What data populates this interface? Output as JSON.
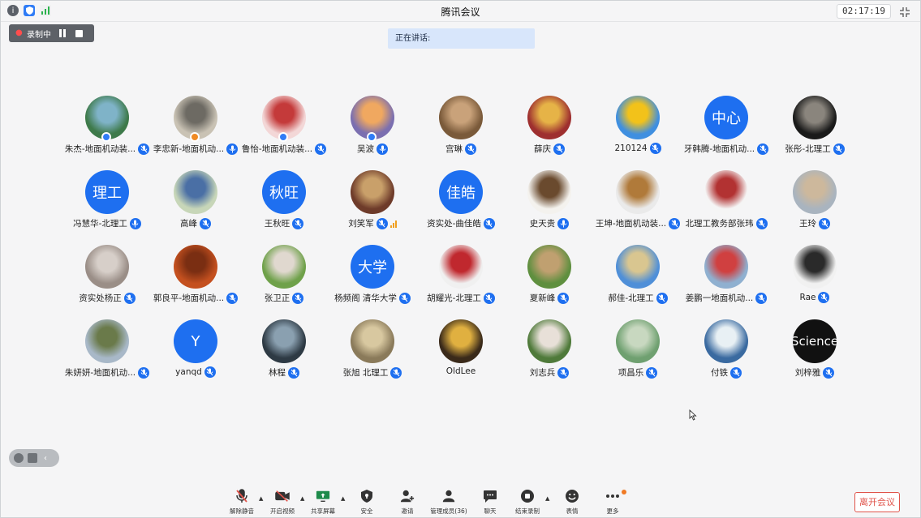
{
  "titlebar": {
    "title": "腾讯会议",
    "timer": "02:17:19"
  },
  "recording": {
    "label": "录制中"
  },
  "speaking": {
    "label": "正在讲话:"
  },
  "colors": {
    "accent": "#1e6ff0",
    "danger": "#e0534a",
    "record_red": "#ff4d4d"
  },
  "participants": [
    {
      "name": "朱杰-地面机动装...",
      "avatar": "photo-lake",
      "mic": "muted",
      "host": "blue"
    },
    {
      "name": "李忠新-地面机动...",
      "avatar": "photo-room",
      "mic": "on",
      "host": "orange"
    },
    {
      "name": "鲁怡-地面机动装...",
      "avatar": "photo-cartoon",
      "mic": "muted",
      "host": "blue"
    },
    {
      "name": "吴波",
      "avatar": "photo-sunset",
      "mic": "on",
      "host": "blue"
    },
    {
      "name": "宫琳",
      "avatar": "photo-man",
      "mic": "muted"
    },
    {
      "name": "薛庆",
      "avatar": "photo-shop",
      "mic": "muted"
    },
    {
      "name": "210124",
      "avatar": "photo-sunflower",
      "mic": "muted"
    },
    {
      "name": "牙韩腾-地面机动...",
      "avatar_text": "中心",
      "mic": "muted"
    },
    {
      "name": "张彤-北理工",
      "avatar": "photo-statue",
      "mic": "muted"
    },
    {
      "name": "冯慧华-北理工",
      "avatar_text": "理工",
      "mic": "on"
    },
    {
      "name": "高峰",
      "avatar": "photo-runner",
      "mic": "muted"
    },
    {
      "name": "王秋旺",
      "avatar_text": "秋旺",
      "mic": "muted"
    },
    {
      "name": "刘笑军",
      "avatar": "photo-books",
      "mic": "muted",
      "speaking": true
    },
    {
      "name": "资实处-曲佳皓",
      "avatar_text": "佳皓",
      "mic": "muted"
    },
    {
      "name": "史天贵",
      "avatar": "photo-coconut",
      "mic": "on"
    },
    {
      "name": "王坤-地面机动装...",
      "avatar": "photo-cartoon2",
      "mic": "muted"
    },
    {
      "name": "北理工教务部张玮",
      "avatar": "photo-logo",
      "mic": "muted"
    },
    {
      "name": "王玲",
      "avatar": "photo-desert",
      "mic": "muted"
    },
    {
      "name": "资实处杨正",
      "avatar": "photo-shell",
      "mic": "muted"
    },
    {
      "name": "郭良平-地面机动...",
      "avatar": "photo-rock",
      "mic": "muted"
    },
    {
      "name": "张卫正",
      "avatar": "photo-woman",
      "mic": "muted"
    },
    {
      "name": "杨频阁 清华大学",
      "avatar_text": "大学",
      "mic": "muted"
    },
    {
      "name": "胡耀光-北理工",
      "avatar": "photo-portrait",
      "mic": "muted"
    },
    {
      "name": "夏新峰",
      "avatar": "photo-child",
      "mic": "muted"
    },
    {
      "name": "郝佳-北理工",
      "avatar": "photo-road",
      "mic": "muted"
    },
    {
      "name": "姜鹏一地面机动...",
      "avatar": "photo-bike",
      "mic": "muted"
    },
    {
      "name": "Rae",
      "avatar": "photo-art",
      "mic": "muted"
    },
    {
      "name": "朱妍妍-地面机动...",
      "avatar": "photo-girl",
      "mic": "muted"
    },
    {
      "name": "yanqd",
      "avatar_text": "Y",
      "mic": "muted"
    },
    {
      "name": "林程",
      "avatar": "photo-bus",
      "mic": "muted"
    },
    {
      "name": "张旭 北理工",
      "avatar": "photo-corridor",
      "mic": "muted"
    },
    {
      "name": "OldLee",
      "avatar": "photo-mosaic",
      "mic": "none"
    },
    {
      "name": "刘志兵",
      "avatar": "photo-football",
      "mic": "muted"
    },
    {
      "name": "项昌乐",
      "avatar": "photo-pond",
      "mic": "muted"
    },
    {
      "name": "付铁",
      "avatar": "photo-tree",
      "mic": "muted"
    },
    {
      "name": "刘梓雅",
      "avatar_text": "Science",
      "avatar_style": "dark",
      "mic": "muted"
    }
  ],
  "toolbar": {
    "mute": "解除静音",
    "video": "开启视频",
    "share": "共享屏幕",
    "security": "安全",
    "invite": "邀请",
    "members": "管理成员(36)",
    "chat": "聊天",
    "end_record": "结束录制",
    "reactions": "表情",
    "more": "更多",
    "leave": "离开会议"
  }
}
